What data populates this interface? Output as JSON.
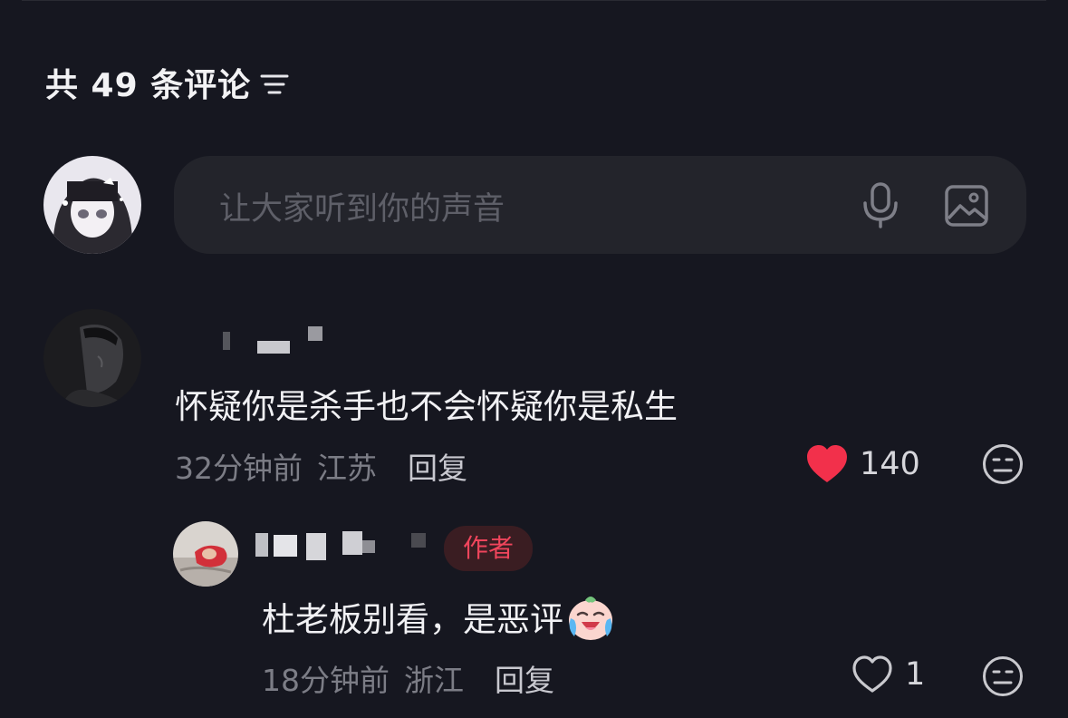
{
  "header": {
    "title": "共 49 条评论",
    "filter_icon": "filter-icon"
  },
  "composer": {
    "placeholder": "让大家听到你的声音",
    "mic_icon": "microphone-icon",
    "image_icon": "image-icon"
  },
  "comments": [
    {
      "text": "怀疑你是杀手也不会怀疑你是私生",
      "time": "32分钟前",
      "location": "江苏",
      "reply_label": "回复",
      "like_count": "140",
      "liked": true,
      "replies": [
        {
          "badge": "作者",
          "text": "杜老板别看，是恶评",
          "time": "18分钟前",
          "location": "浙江",
          "reply_label": "回复",
          "like_count": "1",
          "liked": false
        }
      ]
    }
  ],
  "colors": {
    "background": "#161720",
    "like_red": "#f2304b",
    "badge_text": "#f0455c",
    "badge_bg": "#3a1d22",
    "muted_text": "#7c7d86"
  }
}
